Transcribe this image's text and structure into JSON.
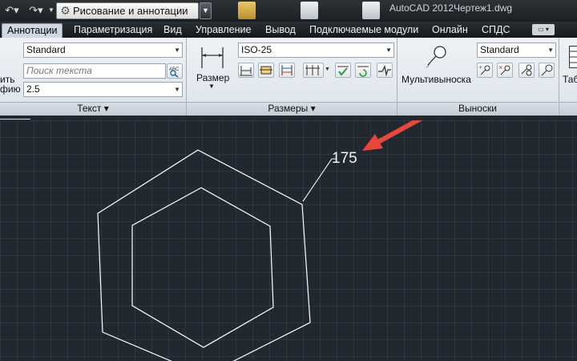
{
  "titlebar": {
    "workspace": "Рисование и аннотации",
    "app_title": "AutoCAD 2012",
    "file_title": "Чертеж1.dwg"
  },
  "tabs": [
    "Аннотации",
    "Параметризация",
    "Вид",
    "Управление",
    "Вывод",
    "Подключаемые модули",
    "Онлайн",
    "СПДС"
  ],
  "ribbon": {
    "text_panel": {
      "style": "Standard",
      "search_placeholder": "Поиск текста",
      "height": "2.5",
      "cut_label_1": "ить",
      "cut_label_2": "фию",
      "footer": "Текст"
    },
    "dim_panel": {
      "big_button": "Размер",
      "style": "ISO-25",
      "footer": "Размеры"
    },
    "leader_panel": {
      "big_button": "Мультивыноска",
      "style": "Standard",
      "footer": "Выноски"
    },
    "table_panel": {
      "big_button_cut": "Таб"
    }
  },
  "drawing": {
    "leader_value": "175"
  },
  "colors": {
    "canvas": "#212830",
    "annotation_arrow": "#e8473c",
    "geometry": "#ffffff"
  }
}
